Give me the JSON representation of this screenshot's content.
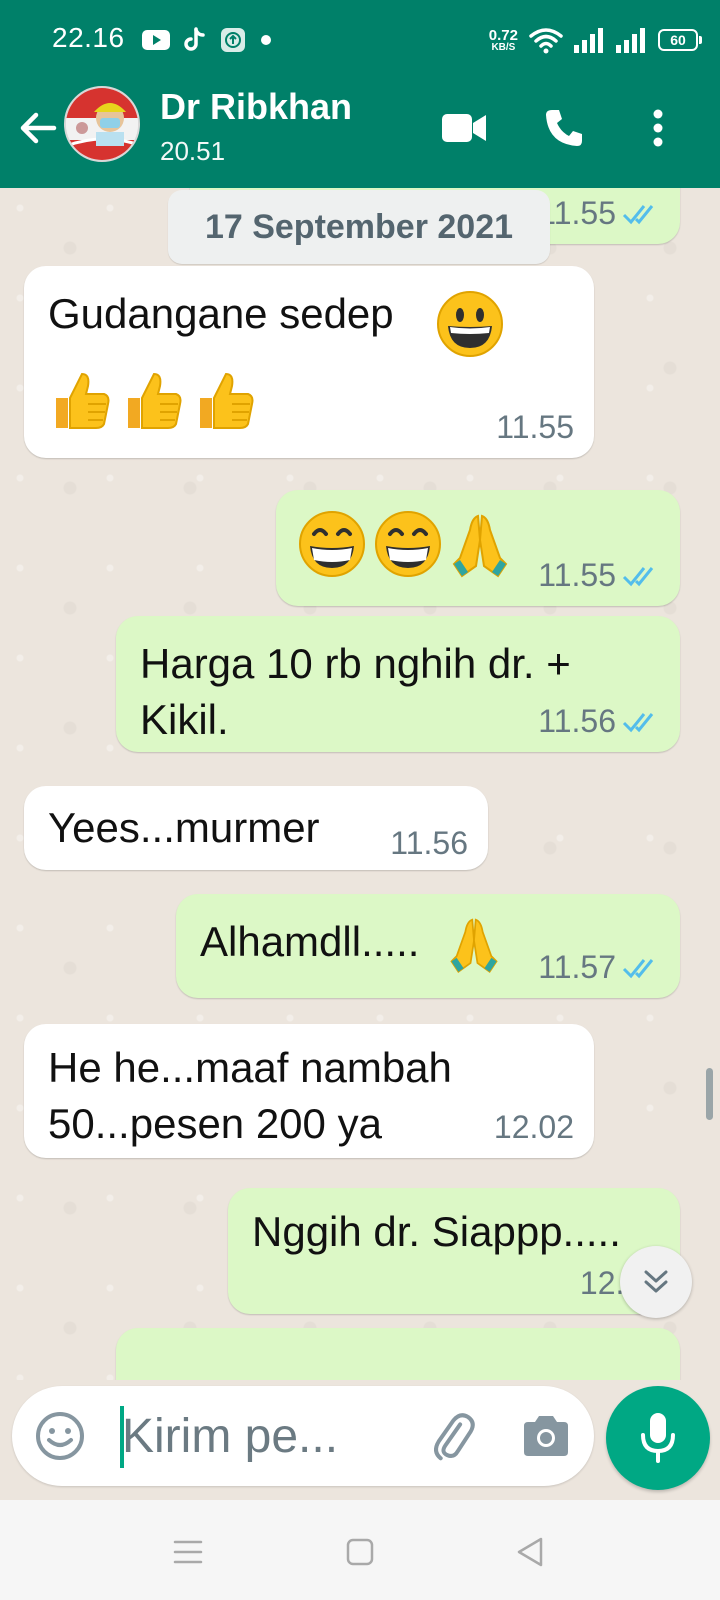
{
  "status_bar": {
    "time": "22.16",
    "net_speed_value": "0.72",
    "net_speed_unit": "KB/S",
    "battery": "60"
  },
  "header": {
    "contact_name": "Dr Ribkhan",
    "contact_status": "20.51"
  },
  "chat": {
    "partial_top_time": "11.55",
    "date_chip": "17 September 2021",
    "messages": [
      {
        "direction": "in",
        "text": "Gudangane sedep",
        "time": "11.55"
      },
      {
        "direction": "out",
        "text": "",
        "time": "11.55"
      },
      {
        "direction": "out",
        "text": "Harga 10 rb nghih dr. +",
        "text2": "Kikil.",
        "time": "11.56"
      },
      {
        "direction": "in",
        "text": "Yees...murmer",
        "time": "11.56"
      },
      {
        "direction": "out",
        "text": "Alhamdll.....",
        "time": "11.57"
      },
      {
        "direction": "in",
        "text": "He he...maaf nambah",
        "text2": "50...pesen 200 ya",
        "time": "12.02"
      },
      {
        "direction": "out",
        "text": "Nggih dr. Siappp.....",
        "time": "12.02"
      }
    ]
  },
  "composer": {
    "placeholder": "Kirim pe..."
  },
  "colors": {
    "brand": "#008069",
    "accent": "#00a884",
    "outgoing_bubble": "#dcf8c6",
    "incoming_bubble": "#ffffff",
    "read_tick": "#53bdeb"
  }
}
